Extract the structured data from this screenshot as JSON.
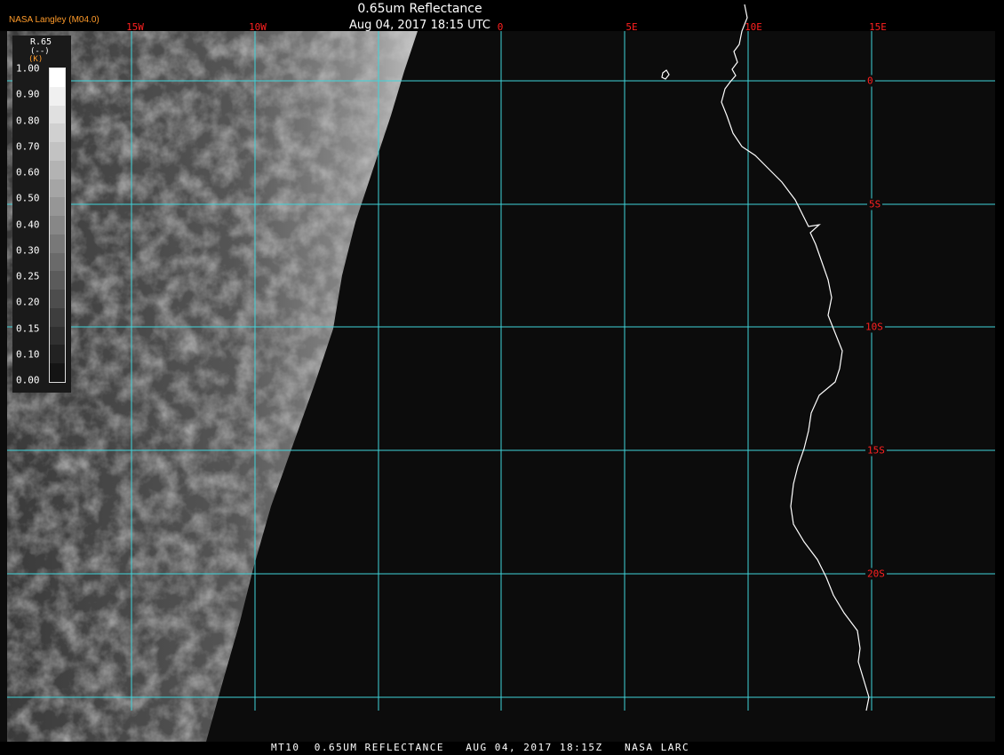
{
  "header": {
    "title": "0.65um Reflectance",
    "subtitle": "Aug 04, 2017 18:15 UTC",
    "credit": "NASA Langley (M04.0)"
  },
  "map": {
    "lon_labels": [
      "15W",
      "10W",
      "0",
      "5E",
      "10E",
      "15E"
    ],
    "lat_labels": [
      "0",
      "5S",
      "10S",
      "15S",
      "20S"
    ],
    "grid_color": "#3fd4da",
    "label_color": "#ff2020",
    "coast_color": "#ffffff",
    "background_color": "#0c0c0c"
  },
  "legend": {
    "variable": "R.65",
    "units": "(--)",
    "unit_k": "(K)",
    "ticks": [
      "1.00",
      "0.90",
      "0.80",
      "0.70",
      "0.60",
      "0.50",
      "0.40",
      "0.30",
      "0.25",
      "0.20",
      "0.15",
      "0.10",
      "0.00"
    ],
    "colors": [
      "#ffffff",
      "#f0f0f0",
      "#e0e0e0",
      "#d0d0d0",
      "#c2c2c2",
      "#b3b3b3",
      "#a5a5a5",
      "#969696",
      "#878787",
      "#787878",
      "#6a6a6a",
      "#5b5b5b",
      "#4d4d4d",
      "#3e3e3e",
      "#303030",
      "#222222",
      "#141414"
    ]
  },
  "footer": {
    "text": "MT10  0.65UM REFLECTANCE   AUG 04, 2017 18:15Z   NASA LARC"
  }
}
